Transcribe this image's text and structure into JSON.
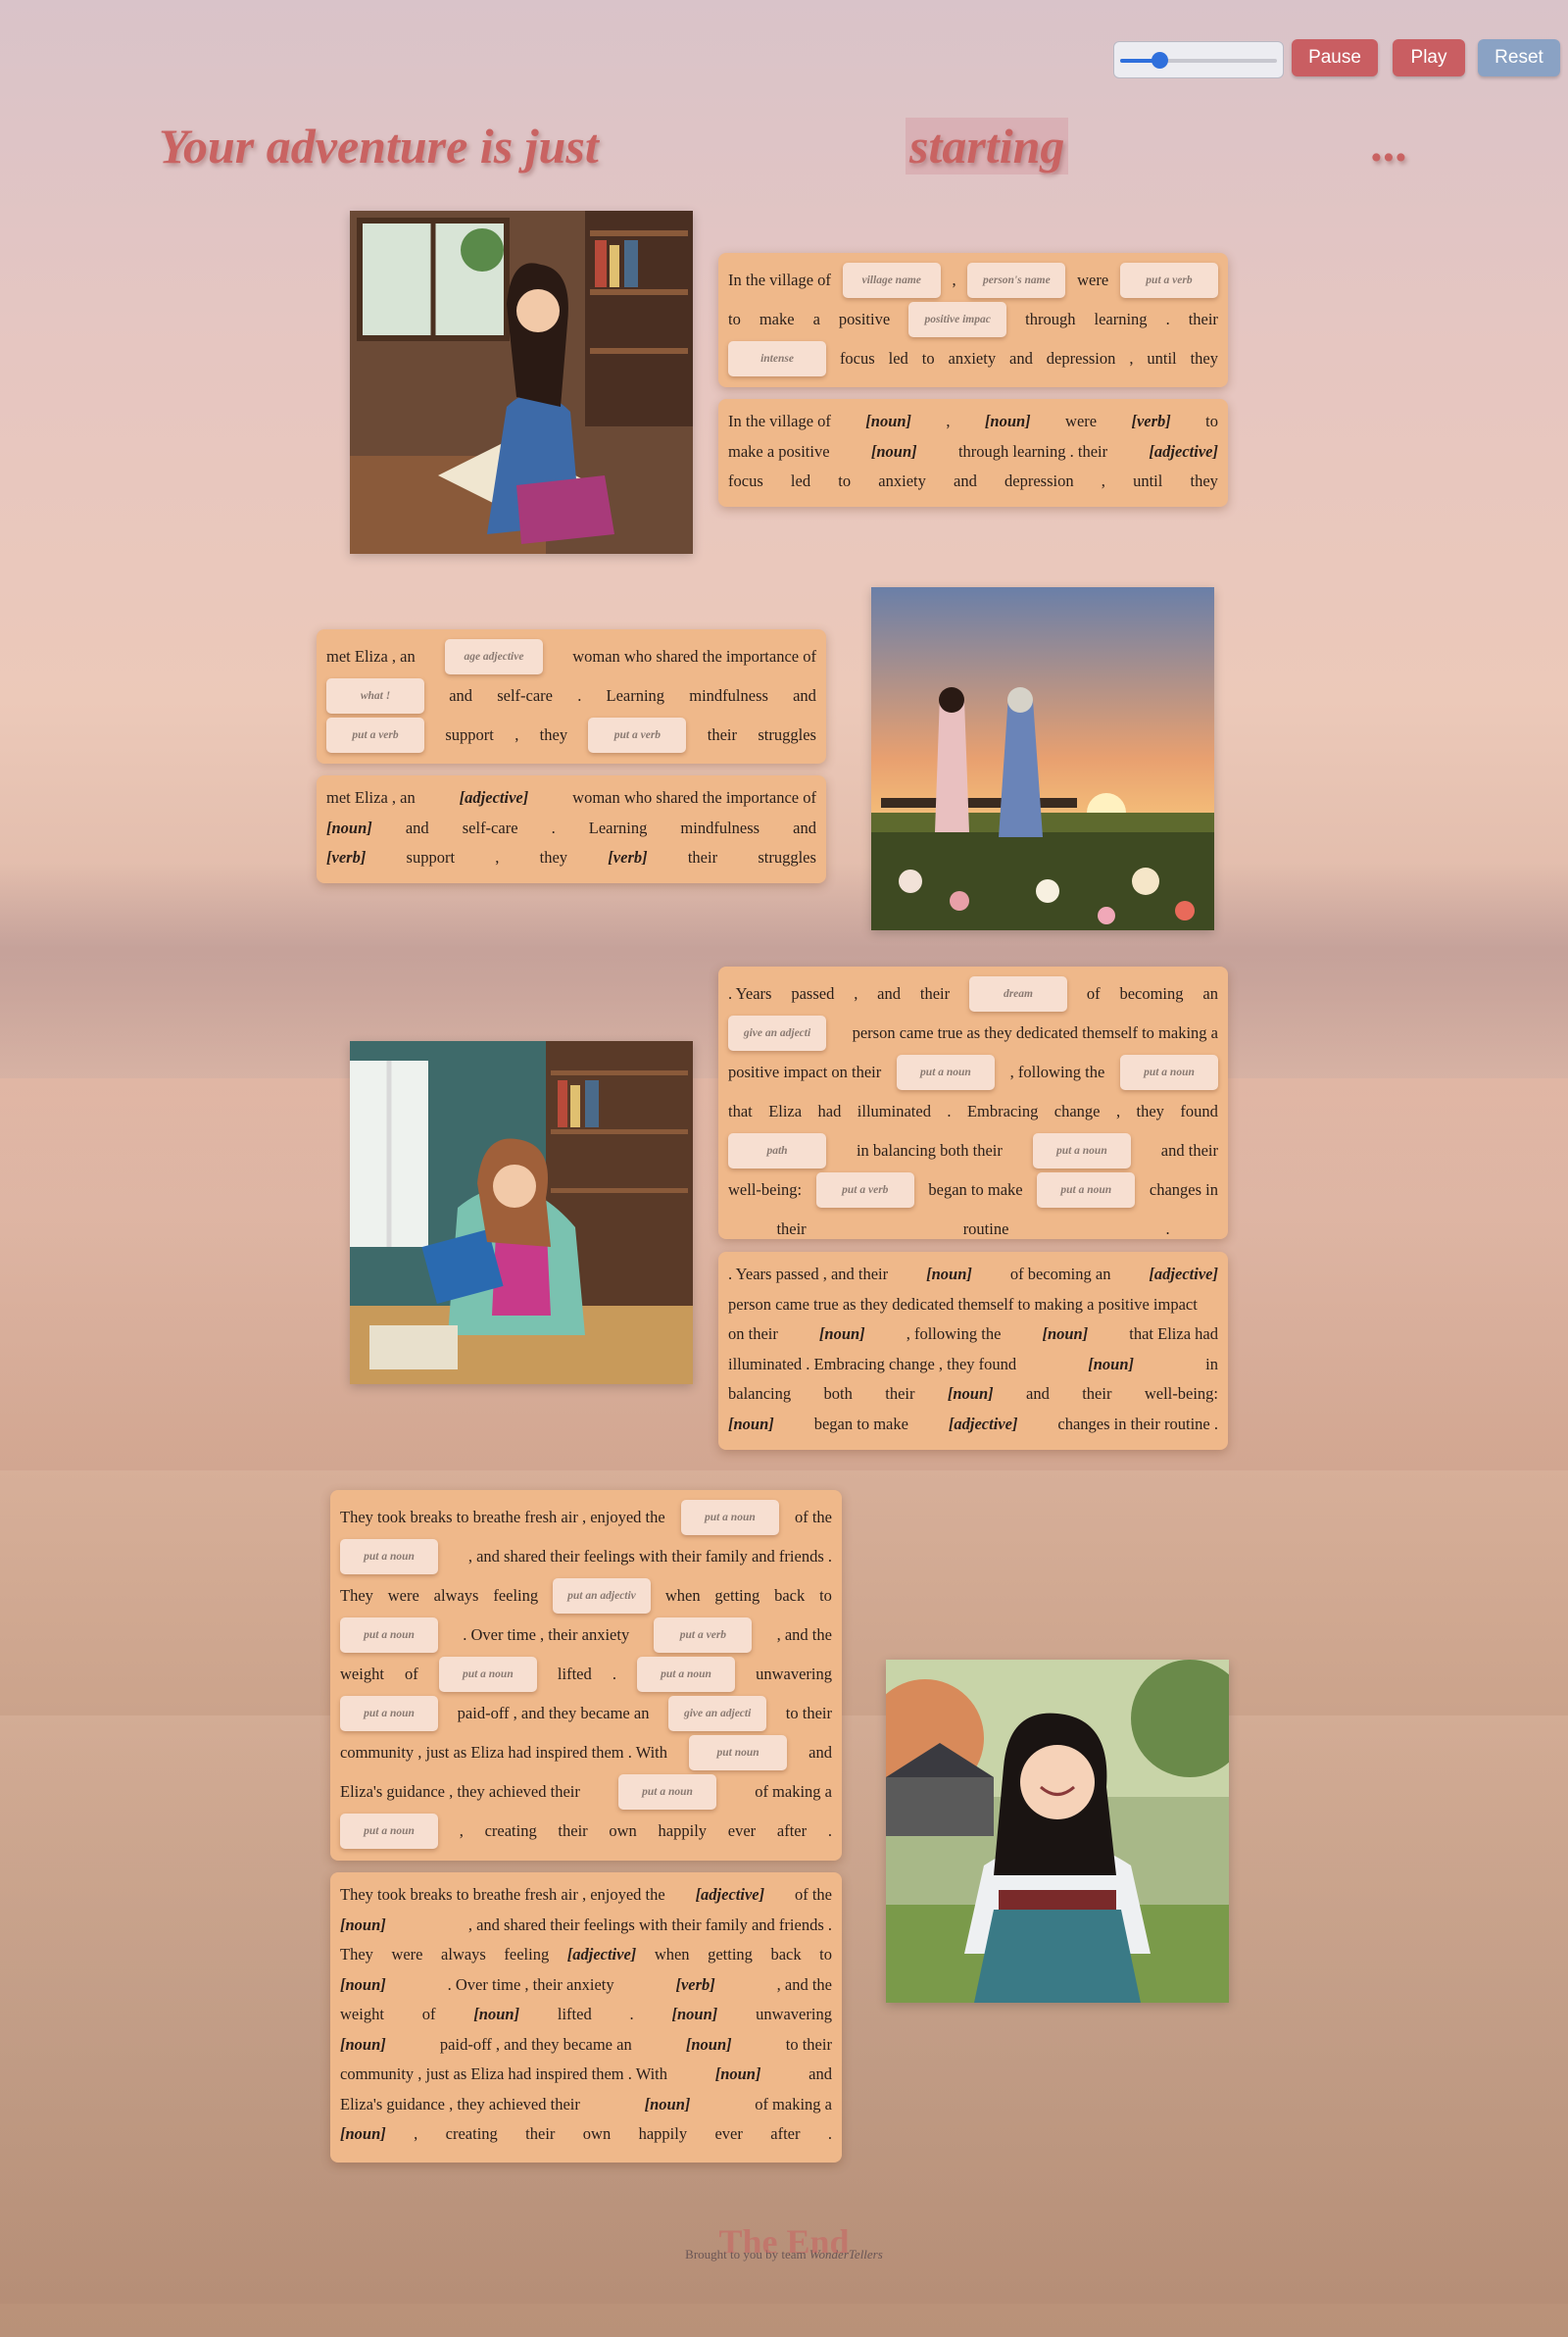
{
  "controls": {
    "slider": {
      "value_fraction": 0.25
    },
    "pause_label": "Pause",
    "play_label": "Play",
    "reset_label": "Reset",
    "accent_color": "#c95e62",
    "reset_color": "#8aa2c4"
  },
  "title": {
    "part1": "Your adventure is just",
    "part2": "starting",
    "part3": "..."
  },
  "images": [
    {
      "name": "girl-reading-by-window-image"
    },
    {
      "name": "two-women-sunset-field-image"
    },
    {
      "name": "woman-studying-library-image"
    },
    {
      "name": "girl-running-traditional-dress-image"
    }
  ],
  "sections": [
    {
      "input_lines": [
        [
          "In the village of",
          {
            "chip": "village name"
          },
          ",",
          {
            "chip": "person's name"
          },
          "were",
          {
            "chip": "put a verb"
          }
        ],
        [
          "to",
          "make",
          "a",
          "positive",
          {
            "chip": "positive impac"
          },
          "through",
          "learning",
          ".",
          "their"
        ],
        [
          {
            "chip": "intense"
          },
          "focus",
          "led",
          "to",
          "anxiety",
          "and",
          "depression",
          ",",
          "until",
          "they"
        ]
      ],
      "filled_lines": [
        [
          "In the village of",
          {
            "ph": "[noun]"
          },
          ",",
          {
            "ph": "[noun]"
          },
          "were",
          {
            "ph": "[verb]"
          },
          "to"
        ],
        [
          "make a positive",
          {
            "ph": "[noun]"
          },
          "through learning . their",
          {
            "ph": "[adjective]"
          }
        ],
        [
          "focus",
          "led",
          "to",
          "anxiety",
          "and",
          "depression",
          ",",
          "until",
          "they"
        ]
      ]
    },
    {
      "input_lines": [
        [
          "met Eliza , an",
          {
            "chip": "age adjective"
          },
          "woman who shared the importance of"
        ],
        [
          {
            "chip": "what !"
          },
          "and",
          "self-care",
          ".",
          "Learning",
          "mindfulness",
          "and"
        ],
        [
          {
            "chip": "put a verb"
          },
          "support",
          ",",
          "they",
          {
            "chip": "put a verb"
          },
          "their",
          "struggles"
        ]
      ],
      "filled_lines": [
        [
          "met Eliza , an",
          {
            "ph": "[adjective]"
          },
          "woman who shared the importance of"
        ],
        [
          {
            "ph": "[noun]"
          },
          "and",
          "self-care",
          ".",
          "Learning",
          "mindfulness",
          "and"
        ],
        [
          {
            "ph": "[verb]"
          },
          "support",
          ",",
          "they",
          {
            "ph": "[verb]"
          },
          "their",
          "struggles"
        ]
      ]
    },
    {
      "input_lines": [
        [
          ". Years",
          "passed",
          ",",
          "and",
          "their",
          {
            "chip": "dream"
          },
          "of",
          "becoming",
          "an"
        ],
        [
          {
            "chip": "give an adjecti"
          },
          "person came true as they dedicated themself to making a"
        ],
        [
          "positive impact on their",
          {
            "chip": "put a noun"
          },
          ", following the",
          {
            "chip": "put a noun"
          }
        ],
        [
          "that",
          "Eliza",
          "had",
          "illuminated",
          ".",
          "Embracing",
          "change",
          ",",
          "they",
          "found"
        ],
        [
          {
            "chip": "path"
          },
          "in balancing both their",
          {
            "chip": "put a noun"
          },
          "and their"
        ],
        [
          "well-being:",
          {
            "chip": "put a verb"
          },
          "began to make",
          {
            "chip": "put a noun"
          },
          "changes in"
        ],
        [
          "their",
          "routine",
          "."
        ]
      ],
      "filled_lines": [
        [
          ". Years passed , and their",
          {
            "ph": "[noun]"
          },
          "of becoming an",
          {
            "ph": "[adjective]"
          }
        ],
        [
          "person came true as they dedicated themself to making a positive impact"
        ],
        [
          "on their",
          {
            "ph": "[noun]"
          },
          ", following the",
          {
            "ph": "[noun]"
          },
          "that Eliza had"
        ],
        [
          "illuminated . Embracing change , they found",
          {
            "ph": "[noun]"
          },
          "in"
        ],
        [
          "balancing",
          "both",
          "their",
          {
            "ph": "[noun]"
          },
          "and",
          "their",
          "well-being:"
        ],
        [
          {
            "ph": "[noun]"
          },
          "began to make",
          {
            "ph": "[adjective]"
          },
          "changes in their routine ."
        ]
      ]
    },
    {
      "input_lines": [
        [
          "They took breaks to breathe fresh air , enjoyed the",
          {
            "chip": "put a noun"
          },
          "of the"
        ],
        [
          {
            "chip": "put a noun"
          },
          ", and shared their feelings with their family and friends ."
        ],
        [
          "They",
          "were",
          "always",
          "feeling",
          {
            "chip": "put an adjectiv"
          },
          "when",
          "getting",
          "back",
          "to"
        ],
        [
          {
            "chip": "put a noun"
          },
          ". Over time , their anxiety",
          {
            "chip": "put a verb"
          },
          ", and the"
        ],
        [
          "weight",
          "of",
          {
            "chip": "put a noun"
          },
          "lifted",
          ".",
          {
            "chip": "put a noun"
          },
          "unwavering"
        ],
        [
          {
            "chip": "put a noun"
          },
          "paid-off , and they became an",
          {
            "chip": "give an adjecti"
          },
          "to their"
        ],
        [
          "community , just as Eliza had inspired them . With",
          {
            "chip": "put noun"
          },
          "and"
        ],
        [
          "Eliza's guidance , they achieved their",
          {
            "chip": "put a noun"
          },
          "of making a"
        ],
        [
          {
            "chip": "put a noun"
          },
          ",",
          "creating",
          "their",
          "own",
          "happily",
          "ever",
          "after",
          "."
        ]
      ],
      "filled_lines": [
        [
          "They took breaks to breathe fresh air , enjoyed the",
          {
            "ph": "[adjective]"
          },
          "of the"
        ],
        [
          {
            "ph": "[noun]"
          },
          ", and shared their feelings with their family and friends ."
        ],
        [
          "They",
          "were",
          "always",
          "feeling",
          {
            "ph": "[adjective]"
          },
          "when",
          "getting",
          "back",
          "to"
        ],
        [
          {
            "ph": "[noun]"
          },
          ". Over time , their anxiety",
          {
            "ph": "[verb]"
          },
          ", and the"
        ],
        [
          "weight",
          "of",
          {
            "ph": "[noun]"
          },
          "lifted",
          ".",
          {
            "ph": "[noun]"
          },
          "unwavering"
        ],
        [
          {
            "ph": "[noun]"
          },
          "paid-off , and they became an",
          {
            "ph": "[noun]"
          },
          "to their"
        ],
        [
          "community , just as Eliza had inspired them . With",
          {
            "ph": "[noun]"
          },
          "and"
        ],
        [
          "Eliza's guidance , they achieved their",
          {
            "ph": "[noun]"
          },
          "of making a"
        ],
        [
          {
            "ph": "[noun]"
          },
          ",",
          "creating",
          "their",
          "own",
          "happily",
          "ever",
          "after",
          "."
        ]
      ]
    }
  ],
  "footer": {
    "end_title": "The End",
    "credit_prefix": "Brought to you by team",
    "credit_team": "WonderTellers"
  }
}
